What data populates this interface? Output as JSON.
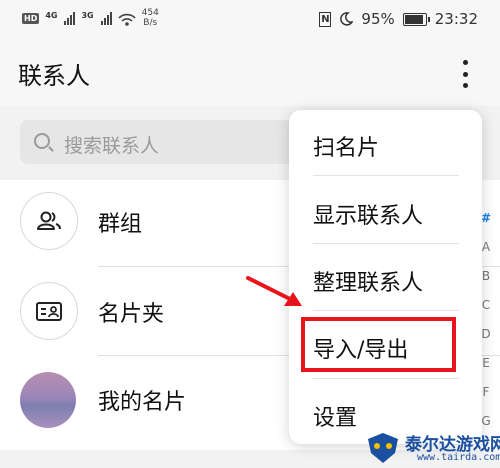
{
  "status_bar": {
    "hd_badge": "HD",
    "network_1": "4G",
    "network_2": "3G",
    "net_speed_value": "454",
    "net_speed_unit": "B/s",
    "nfc_label": "N",
    "battery": "95%",
    "time": "23:32",
    "icons": [
      "hd-icon",
      "signal-icon",
      "wifi-icon",
      "nfc-icon",
      "moon-icon",
      "battery-icon"
    ]
  },
  "header": {
    "title": "联系人",
    "more_icon": "more-vertical-icon"
  },
  "search": {
    "placeholder": "搜索联系人"
  },
  "list": [
    {
      "label": "群组",
      "icon": "group-icon"
    },
    {
      "label": "名片夹",
      "icon": "card-holder-icon"
    },
    {
      "label": "我的名片",
      "icon": "profile-photo"
    }
  ],
  "alphabet_index": [
    "#",
    "A",
    "B",
    "C",
    "D",
    "E",
    "F",
    "G"
  ],
  "menu": {
    "items": [
      "扫名片",
      "显示联系人",
      "整理联系人",
      "导入/导出",
      "设置"
    ],
    "highlighted_index": 3
  },
  "annotation": {
    "arrow_color": "#e8141c",
    "highlight_color": "#e8141c"
  },
  "watermark": {
    "title": "泰尔达游戏网",
    "url": "www.tairda.com"
  }
}
